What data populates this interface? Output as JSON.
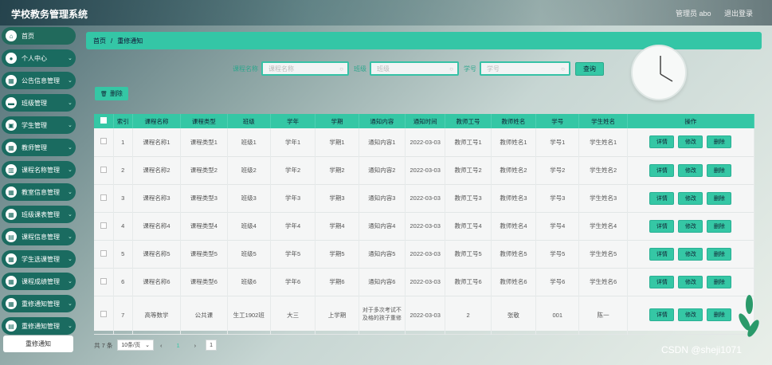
{
  "app": {
    "title": "学校教务管理系统"
  },
  "header": {
    "user_label": "管理员 abo",
    "logout_label": "退出登录"
  },
  "sidebar": {
    "items": [
      {
        "label": "首页",
        "icon": "home-icon",
        "expandable": false
      },
      {
        "label": "个人中心",
        "icon": "user-icon",
        "expandable": true
      },
      {
        "label": "公告信息管理",
        "icon": "grid-icon",
        "expandable": true
      },
      {
        "label": "班级管理",
        "icon": "card-icon",
        "expandable": true
      },
      {
        "label": "学生管理",
        "icon": "calendar-icon",
        "expandable": true
      },
      {
        "label": "教师管理",
        "icon": "grid-icon",
        "expandable": true
      },
      {
        "label": "课程名称管理",
        "icon": "chart-icon",
        "expandable": true
      },
      {
        "label": "教室信息管理",
        "icon": "grid-icon",
        "expandable": true
      },
      {
        "label": "班级课表管理",
        "icon": "grid-icon",
        "expandable": true
      },
      {
        "label": "课程信息管理",
        "icon": "folder-icon",
        "expandable": true
      },
      {
        "label": "学生选课管理",
        "icon": "grid-icon",
        "expandable": true
      },
      {
        "label": "课程成绩管理",
        "icon": "grid-icon",
        "expandable": true
      },
      {
        "label": "重修通知管理",
        "icon": "grid-icon",
        "expandable": true
      },
      {
        "label": "重修通知管理",
        "icon": "folder-icon",
        "expandable": true
      }
    ],
    "sub_item": "重修通知"
  },
  "breadcrumb": {
    "home": "首页",
    "separator": "/",
    "current": "重修通知"
  },
  "search": {
    "course_name_label": "课程名称",
    "course_name_placeholder": "课程名称",
    "class_label": "班级",
    "class_placeholder": "班级",
    "student_id_label": "学号",
    "student_id_placeholder": "学号",
    "search_button": "查询"
  },
  "toolbar": {
    "delete_label": "删除"
  },
  "table": {
    "headers": [
      "索引",
      "课程名称",
      "课程类型",
      "班级",
      "学年",
      "学期",
      "通知内容",
      "通知时间",
      "教师工号",
      "教师姓名",
      "学号",
      "学生姓名",
      "操作"
    ],
    "actions": [
      "详情",
      "修改",
      "删除"
    ],
    "rows": [
      [
        "1",
        "课程名称1",
        "课程类型1",
        "班级1",
        "学年1",
        "学期1",
        "通知内容1",
        "2022-03-03",
        "教师工号1",
        "教师姓名1",
        "学号1",
        "学生姓名1"
      ],
      [
        "2",
        "课程名称2",
        "课程类型2",
        "班级2",
        "学年2",
        "学期2",
        "通知内容2",
        "2022-03-03",
        "教师工号2",
        "教师姓名2",
        "学号2",
        "学生姓名2"
      ],
      [
        "3",
        "课程名称3",
        "课程类型3",
        "班级3",
        "学年3",
        "学期3",
        "通知内容3",
        "2022-03-03",
        "教师工号3",
        "教师姓名3",
        "学号3",
        "学生姓名3"
      ],
      [
        "4",
        "课程名称4",
        "课程类型4",
        "班级4",
        "学年4",
        "学期4",
        "通知内容4",
        "2022-03-03",
        "教师工号4",
        "教师姓名4",
        "学号4",
        "学生姓名4"
      ],
      [
        "5",
        "课程名称5",
        "课程类型5",
        "班级5",
        "学年5",
        "学期5",
        "通知内容5",
        "2022-03-03",
        "教师工号5",
        "教师姓名5",
        "学号5",
        "学生姓名5"
      ],
      [
        "6",
        "课程名称6",
        "课程类型6",
        "班级6",
        "学年6",
        "学期6",
        "通知内容6",
        "2022-03-03",
        "教师工号6",
        "教师姓名6",
        "学号6",
        "学生姓名6"
      ],
      [
        "7",
        "高等数学",
        "公共课",
        "生工1902班",
        "大三",
        "上学期",
        "对于多次考试不及格的孩子重修",
        "2022-03-03",
        "2",
        "张敬",
        "001",
        "陈一"
      ]
    ]
  },
  "pagination": {
    "total_label": "共 7 条",
    "page_size": "10条/页",
    "current_page": "1",
    "goto_page": "1"
  },
  "watermark": "CSDN @sheji1071",
  "colors": {
    "accent": "#35c7a5",
    "sidebar": "#1a6b60"
  }
}
